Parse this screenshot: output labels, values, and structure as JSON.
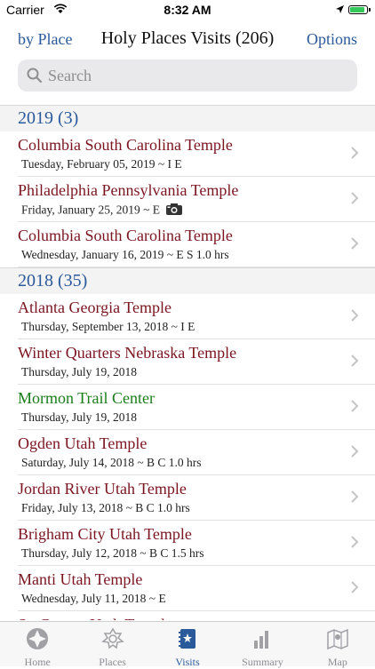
{
  "status": {
    "carrier": "Carrier",
    "time": "8:32 AM"
  },
  "nav": {
    "left": "by Place",
    "title": "Holy Places Visits (206)",
    "right": "Options"
  },
  "search": {
    "placeholder": "Search"
  },
  "sections": [
    {
      "header": "2019 (3)",
      "rows": [
        {
          "title": "Columbia South Carolina Temple",
          "sub": "Tuesday, February 05, 2019 ~ I E",
          "kind": "temple",
          "camera": false
        },
        {
          "title": "Philadelphia Pennsylvania Temple",
          "sub": "Friday, January 25, 2019 ~ E",
          "kind": "temple",
          "camera": true
        },
        {
          "title": "Columbia South Carolina Temple",
          "sub": "Wednesday, January 16, 2019 ~ E S 1.0 hrs",
          "kind": "temple",
          "camera": false
        }
      ]
    },
    {
      "header": "2018 (35)",
      "rows": [
        {
          "title": "Atlanta Georgia Temple",
          "sub": "Thursday, September 13, 2018 ~ I E",
          "kind": "temple",
          "camera": false
        },
        {
          "title": "Winter Quarters Nebraska Temple",
          "sub": "Thursday, July 19, 2018",
          "kind": "temple",
          "camera": false
        },
        {
          "title": "Mormon Trail Center",
          "sub": "Thursday, July 19, 2018",
          "kind": "place",
          "camera": false
        },
        {
          "title": "Ogden Utah Temple",
          "sub": "Saturday, July 14, 2018 ~ B C 1.0 hrs",
          "kind": "temple",
          "camera": false
        },
        {
          "title": "Jordan River Utah Temple",
          "sub": "Friday, July 13, 2018 ~ B C 1.0 hrs",
          "kind": "temple",
          "camera": false
        },
        {
          "title": "Brigham City Utah Temple",
          "sub": "Thursday, July 12, 2018 ~ B C 1.5 hrs",
          "kind": "temple",
          "camera": false
        },
        {
          "title": "Manti Utah Temple",
          "sub": "Wednesday, July 11, 2018 ~ E",
          "kind": "temple",
          "camera": false
        },
        {
          "title": "St. George Utah Temple",
          "sub": "",
          "kind": "temple",
          "camera": false
        }
      ]
    }
  ],
  "tabs": [
    {
      "label": "Home",
      "icon": "home-icon",
      "active": false
    },
    {
      "label": "Places",
      "icon": "places-icon",
      "active": false
    },
    {
      "label": "Visits",
      "icon": "visits-icon",
      "active": true
    },
    {
      "label": "Summary",
      "icon": "summary-icon",
      "active": false
    },
    {
      "label": "Map",
      "icon": "map-icon",
      "active": false
    }
  ],
  "colors": {
    "accent": "#2a5a9a",
    "temple": "#7a1520",
    "place": "#1a7d1a"
  }
}
